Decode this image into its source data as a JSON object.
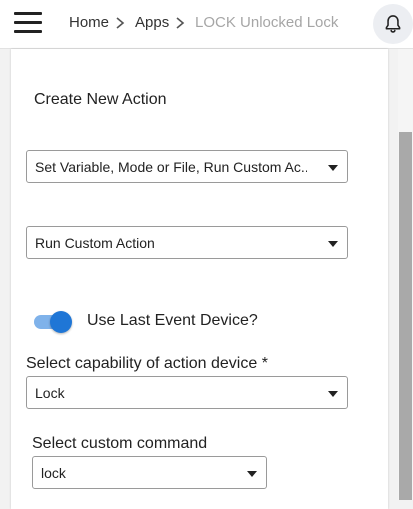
{
  "header": {
    "breadcrumb": {
      "home": "Home",
      "apps": "Apps",
      "current": "LOCK Unlocked Lock"
    }
  },
  "card": {
    "title": "Create New Action",
    "action_type_select": {
      "value": "Set Variable, Mode or File, Run Custom Ac..."
    },
    "action_select": {
      "value": "Run Custom Action"
    },
    "use_last_event_toggle": {
      "label": "Use Last Event Device?",
      "checked": true
    },
    "capability": {
      "label": "Select capability of action device *",
      "value": "Lock"
    },
    "custom_command": {
      "label": "Select custom command",
      "value": "lock"
    }
  },
  "colors": {
    "accent": "#1f76d6",
    "toggle_track": "#7fb2ea",
    "crumb_current": "#a6a6a6"
  },
  "icons": [
    "menu-icon",
    "chevron-right-icon",
    "bell-icon",
    "dropdown-caret-icon"
  ]
}
